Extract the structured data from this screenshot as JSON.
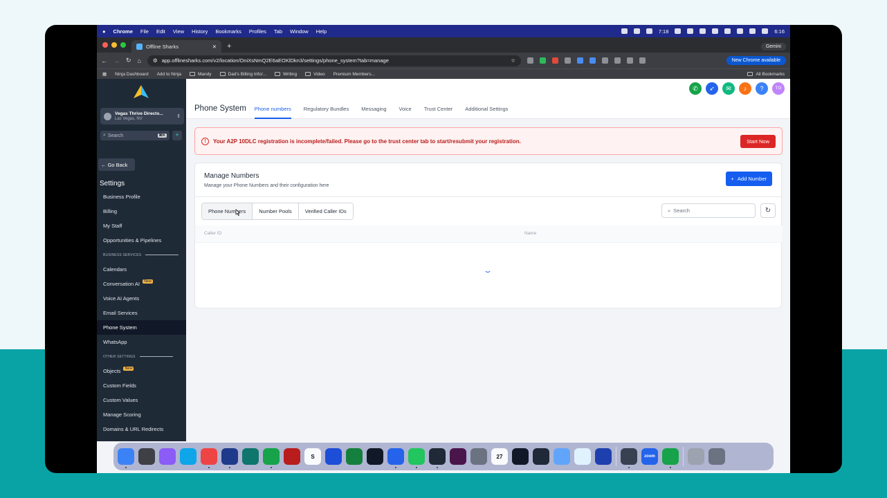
{
  "menubar": {
    "app": "Chrome",
    "items": [
      "File",
      "Edit",
      "View",
      "History",
      "Bookmarks",
      "Profiles",
      "Tab",
      "Window",
      "Help"
    ],
    "time_widget": "7:18",
    "clock": "6:16"
  },
  "browser": {
    "tab_title": "Offline Sharks",
    "gemini": "Gemini",
    "url": "app.offlinesharks.com/v2/location/OniXsNmQ2E6aEOKlDkn3/settings/phone_system?tab=manage",
    "new_chrome": "New Chrome available",
    "bookmarks": [
      "Ninja Dashboard",
      "Add to Ninja",
      "Mandy",
      "Dad's Billing Info/...",
      "Writing",
      "Video",
      "Premium Members..."
    ],
    "all_bookmarks": "All Bookmarks"
  },
  "sidebar": {
    "location_name": "Vegas Thrive Directo...",
    "location_city": "Las Vegas, NV",
    "search_placeholder": "Search",
    "search_shortcut": "⌘K",
    "go_back": "← Go Back",
    "settings_heading": "Settings",
    "items": [
      {
        "label": "Business Profile"
      },
      {
        "label": "Billing"
      },
      {
        "label": "My Staff"
      },
      {
        "label": "Opportunities & Pipelines"
      }
    ],
    "section_business": "BUSINESS SERVICES",
    "business_items": [
      {
        "label": "Calendars"
      },
      {
        "label": "Conversation AI",
        "badge": "New"
      },
      {
        "label": "Voice AI Agents"
      },
      {
        "label": "Email Services"
      },
      {
        "label": "Phone System",
        "active": true
      },
      {
        "label": "WhatsApp"
      }
    ],
    "section_other": "OTHER SETTINGS",
    "other_items": [
      {
        "label": "Objects",
        "badge": "New"
      },
      {
        "label": "Custom Fields"
      },
      {
        "label": "Custom Values"
      },
      {
        "label": "Manage Scoring"
      },
      {
        "label": "Domains & URL Redirects"
      }
    ]
  },
  "header": {
    "icons": [
      {
        "name": "phone-icon",
        "color": "#16a34a",
        "glyph": "✆"
      },
      {
        "name": "rocket-icon",
        "color": "#2563eb",
        "glyph": "➶"
      },
      {
        "name": "megaphone-icon",
        "color": "#10b981",
        "glyph": "✉"
      },
      {
        "name": "bell-icon",
        "color": "#f97316",
        "glyph": "♪"
      },
      {
        "name": "help-icon",
        "color": "#3b82f6",
        "glyph": "?"
      },
      {
        "name": "avatar",
        "color": "#c084fc",
        "glyph": "TG"
      }
    ]
  },
  "phone_system": {
    "title": "Phone System",
    "tabs": [
      "Phone numbers",
      "Regulatory Bundles",
      "Messaging",
      "Voice",
      "Trust Center",
      "Additional Settings"
    ],
    "active_tab": "Phone numbers",
    "alert_message": "Your A2P 10DLC registration is incomplete/failed. Please go to the trust center tab to start/resubmit your registration.",
    "alert_button": "Start Now",
    "card_title": "Manage Numbers",
    "card_subtitle": "Manage your Phone Numbers and their configuration here",
    "add_number": "Add Number",
    "sub_tabs": [
      "Phone Numbers",
      "Number Pools",
      "Verified Caller IDs"
    ],
    "search_placeholder": "Search",
    "columns": [
      "Caller ID",
      "Name"
    ]
  },
  "dock": {
    "calendar_day": "27",
    "zoom_label": "zoom"
  },
  "colors": {
    "accent": "#155eef",
    "sidebar_bg": "#1f2a37",
    "alert_red": "#dc2626"
  }
}
